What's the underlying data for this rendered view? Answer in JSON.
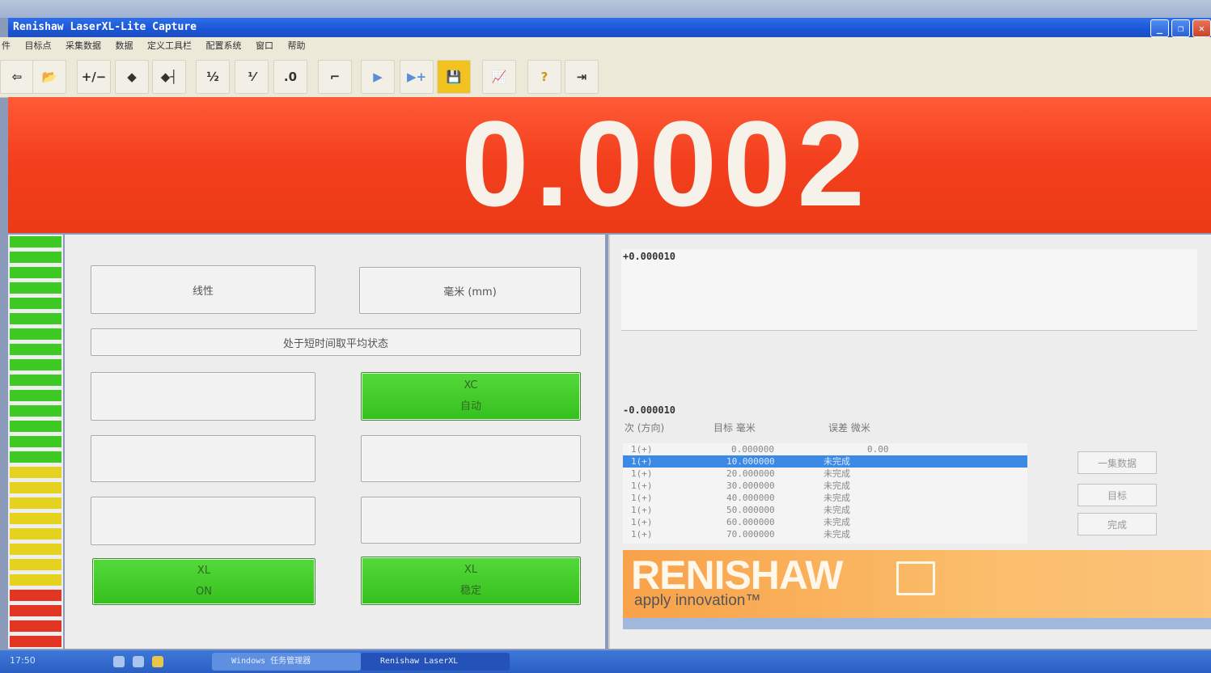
{
  "window": {
    "title": "Renishaw LaserXL-Lite Capture",
    "controls": [
      "_",
      "❐",
      "✕"
    ]
  },
  "menu": [
    "件",
    "目标点",
    "采集数据",
    "数据",
    "定义工具栏",
    "配置系统",
    "窗口",
    "帮助"
  ],
  "toolbar": [
    {
      "icon": "back-arrow-icon",
      "glyph": "⇦"
    },
    {
      "icon": "open-folder-icon",
      "glyph": "📂"
    },
    {
      "icon": "plus-minus-icon",
      "glyph": "+/−"
    },
    {
      "icon": "target-icon",
      "glyph": "◆"
    },
    {
      "icon": "target-set-icon",
      "glyph": "◆┤"
    },
    {
      "icon": "fraction-icon",
      "glyph": "½"
    },
    {
      "icon": "fraction-alt-icon",
      "glyph": "⅟"
    },
    {
      "icon": "decimal-icon",
      "glyph": ".0"
    },
    {
      "icon": "curve-icon",
      "glyph": "⌐"
    },
    {
      "icon": "play-icon",
      "glyph": "▶"
    },
    {
      "icon": "play-add-icon",
      "glyph": "▶+"
    },
    {
      "icon": "save-icon",
      "glyph": "💾"
    },
    {
      "icon": "chart-icon",
      "glyph": "📈"
    },
    {
      "icon": "help-icon",
      "glyph": "?"
    },
    {
      "icon": "exit-icon",
      "glyph": "⇥"
    }
  ],
  "readout": {
    "value": "0.0002"
  },
  "controls": {
    "mode": "线性",
    "units": "毫米 (mm)",
    "status": "处于短时间取平均状态",
    "xc_line1": "XC",
    "xc_line2": "自动",
    "xl_on_line1": "XL",
    "xl_on_line2": "ON",
    "xl_stable_line1": "XL",
    "xl_stable_line2": "稳定"
  },
  "colors": {
    "readout": "#f23e1c",
    "green": "#3ec924",
    "yellow": "#e5d21f",
    "red": "#e23523",
    "logo": "#f9a850"
  },
  "plot": {
    "upper_label": "+0.000010",
    "lower_label": "-0.000010"
  },
  "table": {
    "headers": [
      "次 (方向)",
      "目标 毫米",
      "误差 微米"
    ],
    "rows": [
      {
        "run": "1(+)",
        "target": "0.000000",
        "error": "0.00"
      },
      {
        "run": "1(+)",
        "target": "10.000000",
        "error": "未完成"
      },
      {
        "run": "1(+)",
        "target": "20.000000",
        "error": "未完成"
      },
      {
        "run": "1(+)",
        "target": "30.000000",
        "error": "未完成"
      },
      {
        "run": "1(+)",
        "target": "40.000000",
        "error": "未完成"
      },
      {
        "run": "1(+)",
        "target": "50.000000",
        "error": "未完成"
      },
      {
        "run": "1(+)",
        "target": "60.000000",
        "error": "未完成"
      },
      {
        "run": "1(+)",
        "target": "70.000000",
        "error": "未完成"
      }
    ]
  },
  "side_buttons": [
    "一集数据",
    "目标",
    "完成"
  ],
  "brand": {
    "name": "RENISHAW",
    "tagline": "apply innovation™"
  },
  "taskbar": {
    "clock": "17:50",
    "tasks": [
      "Windows 任务管理器",
      "Renishaw LaserXL"
    ]
  }
}
